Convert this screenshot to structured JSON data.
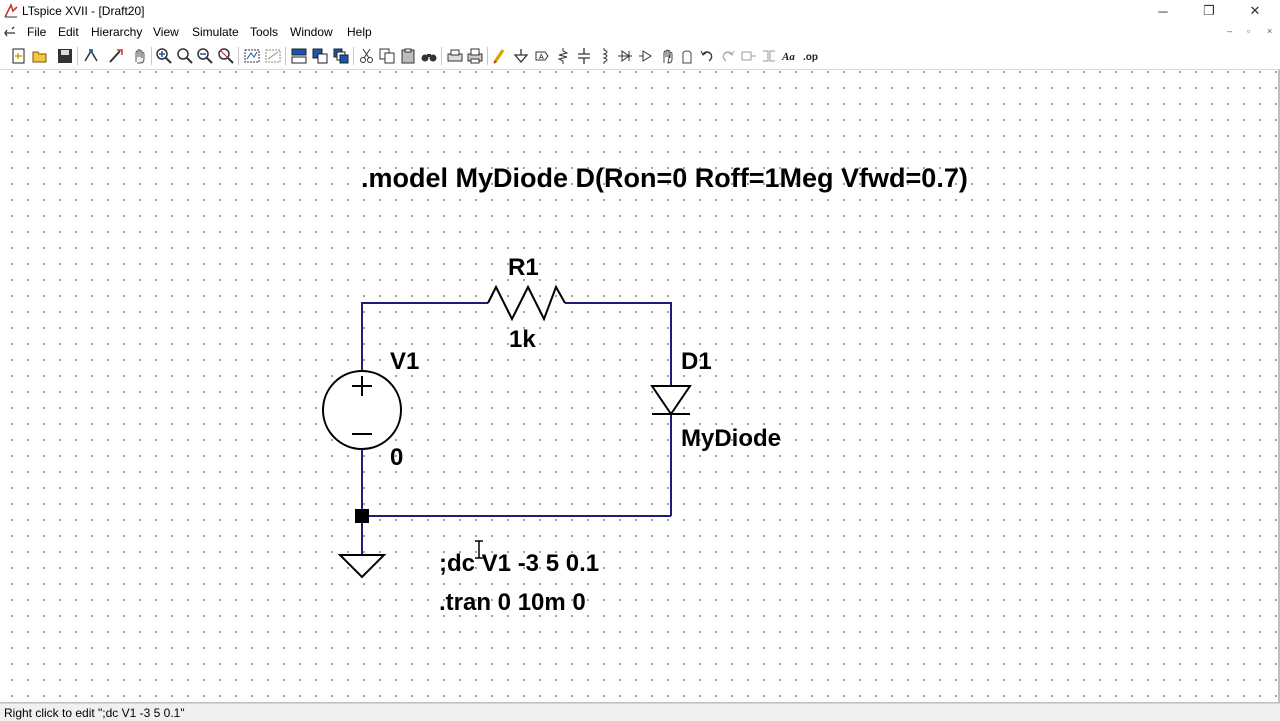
{
  "window": {
    "title": "LTspice XVII - [Draft20]",
    "minimize_glyph": "─",
    "restore_glyph": "❐",
    "close_glyph": "✕"
  },
  "menu": {
    "items": [
      "File",
      "Edit",
      "Hierarchy",
      "View",
      "Simulate",
      "Tools",
      "Window",
      "Help"
    ]
  },
  "toolbar": {
    "icons": [
      "new-schematic-icon",
      "open-icon",
      "save-icon",
      "control-panel-icon",
      "run-icon",
      "halt-icon",
      "zoom-in-icon",
      "zoom-pan-icon",
      "zoom-out-icon",
      "zoom-fit-icon",
      "autoscale-icon",
      "autoscale-plot-icon",
      "tile-horizontal-icon",
      "tile-vertical-icon",
      "cascade-icon",
      "cut-icon",
      "copy-icon",
      "paste-icon",
      "find-icon",
      "print-preview-icon",
      "print-icon",
      "draw-wire-icon",
      "ground-icon",
      "label-net-icon",
      "resistor-icon",
      "capacitor-icon",
      "inductor-icon",
      "diode-icon",
      "component-icon",
      "move-icon",
      "drag-icon",
      "undo-icon",
      "redo-icon",
      "rotate-icon",
      "mirror-icon",
      "text-icon",
      "spice-directive-icon"
    ]
  },
  "schematic": {
    "model_directive": ".model MyDiode D(Ron=0 Roff=1Meg Vfwd=0.7)",
    "r1": {
      "name": "R1",
      "value": "1k"
    },
    "v1": {
      "name": "V1",
      "value": "0"
    },
    "d1": {
      "name": "D1",
      "value": "MyDiode"
    },
    "dc_directive": ";dc V1 -3 5 0.1",
    "tran_directive": ".tran 0 10m 0"
  },
  "status": {
    "text": "Right click to edit \";dc V1 -3 5 0.1\""
  }
}
